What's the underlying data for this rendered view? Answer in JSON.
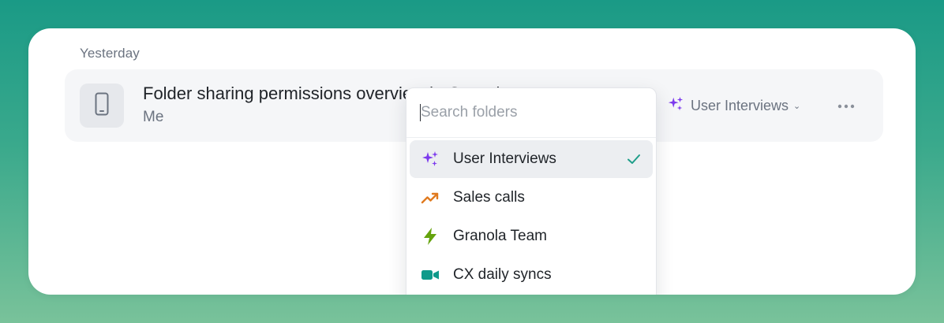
{
  "section": {
    "label": "Yesterday"
  },
  "note": {
    "title": "Folder sharing permissions overview in Granola",
    "author": "Me",
    "icon": "phone-icon"
  },
  "folder_chip": {
    "label": "User Interviews",
    "icon": "sparkles-icon",
    "chevron": "⌄"
  },
  "more_button": {
    "icon": "more-horizontal-icon"
  },
  "dropdown": {
    "search_placeholder": "Search folders",
    "search_value": "",
    "items": [
      {
        "label": "User Interviews",
        "icon": "sparkles-icon",
        "color": "#7c3aed",
        "selected": true
      },
      {
        "label": "Sales calls",
        "icon": "trending-up-icon",
        "color": "#e07a1f",
        "selected": false
      },
      {
        "label": "Granola Team",
        "icon": "lightning-icon",
        "color": "#65a30d",
        "selected": false
      },
      {
        "label": "CX daily syncs",
        "icon": "video-camera-icon",
        "color": "#0f9a8a",
        "selected": false
      }
    ]
  },
  "colors": {
    "accent_purple": "#7c3aed",
    "check_green": "#1f9e8a",
    "background_teal": "#1a9a86"
  }
}
